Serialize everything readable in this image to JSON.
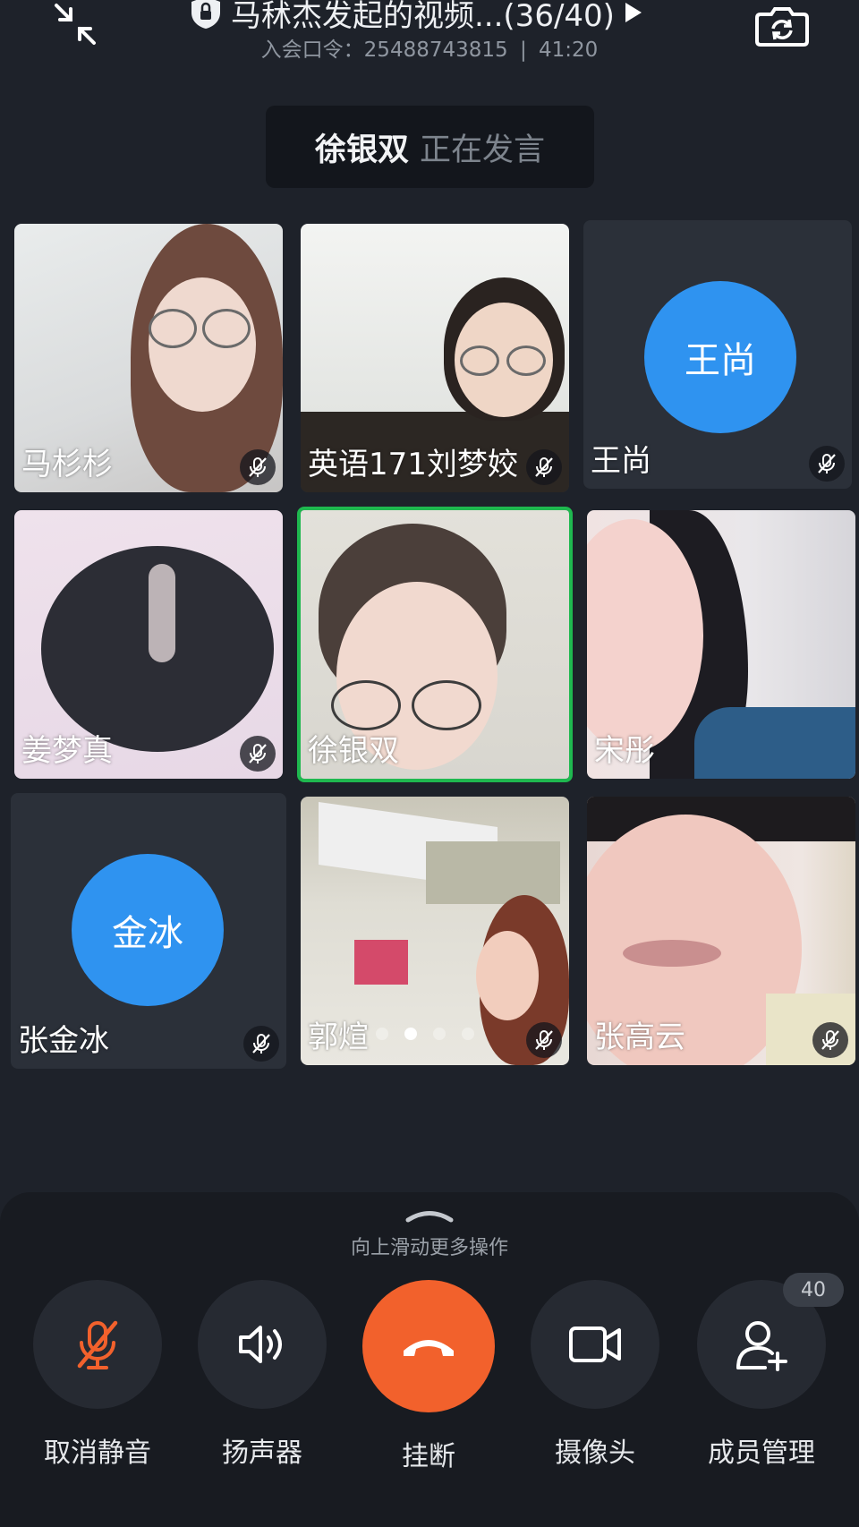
{
  "header": {
    "title": "马秫杰发起的视频...(36/40)",
    "passcode_label": "入会口令：",
    "passcode": "25488743815",
    "separator": "|",
    "duration": "41:20"
  },
  "speaker": {
    "name": "徐银双",
    "status": "正在发言"
  },
  "participants": [
    {
      "name": "马杉杉",
      "avatar": ""
    },
    {
      "name": "英语171刘梦姣",
      "avatar": ""
    },
    {
      "name": "王尚",
      "avatar": "王尚"
    },
    {
      "name": "姜梦真",
      "avatar": ""
    },
    {
      "name": "徐银双",
      "avatar": ""
    },
    {
      "name": "宋彤",
      "avatar": ""
    },
    {
      "name": "张金冰",
      "avatar": "金冰"
    },
    {
      "name": "郭煊",
      "avatar": ""
    },
    {
      "name": "张高云",
      "avatar": ""
    }
  ],
  "controls": {
    "swipe_hint": "向上滑动更多操作",
    "unmute": "取消静音",
    "speaker": "扬声器",
    "hangup": "挂断",
    "camera": "摄像头",
    "members": "成员管理",
    "member_count": "40"
  },
  "colors": {
    "background": "#1e222a",
    "active_border": "#1fb84f",
    "avatar": "#2f93f0",
    "hangup": "#f2612c",
    "muted_icon": "#f2612c"
  },
  "icons": [
    "shrink-icon",
    "lock-icon",
    "play-icon",
    "camera-switch-icon",
    "mic-off-icon",
    "speaker-icon",
    "phone-hangup-icon",
    "video-camera-icon",
    "add-user-icon"
  ]
}
